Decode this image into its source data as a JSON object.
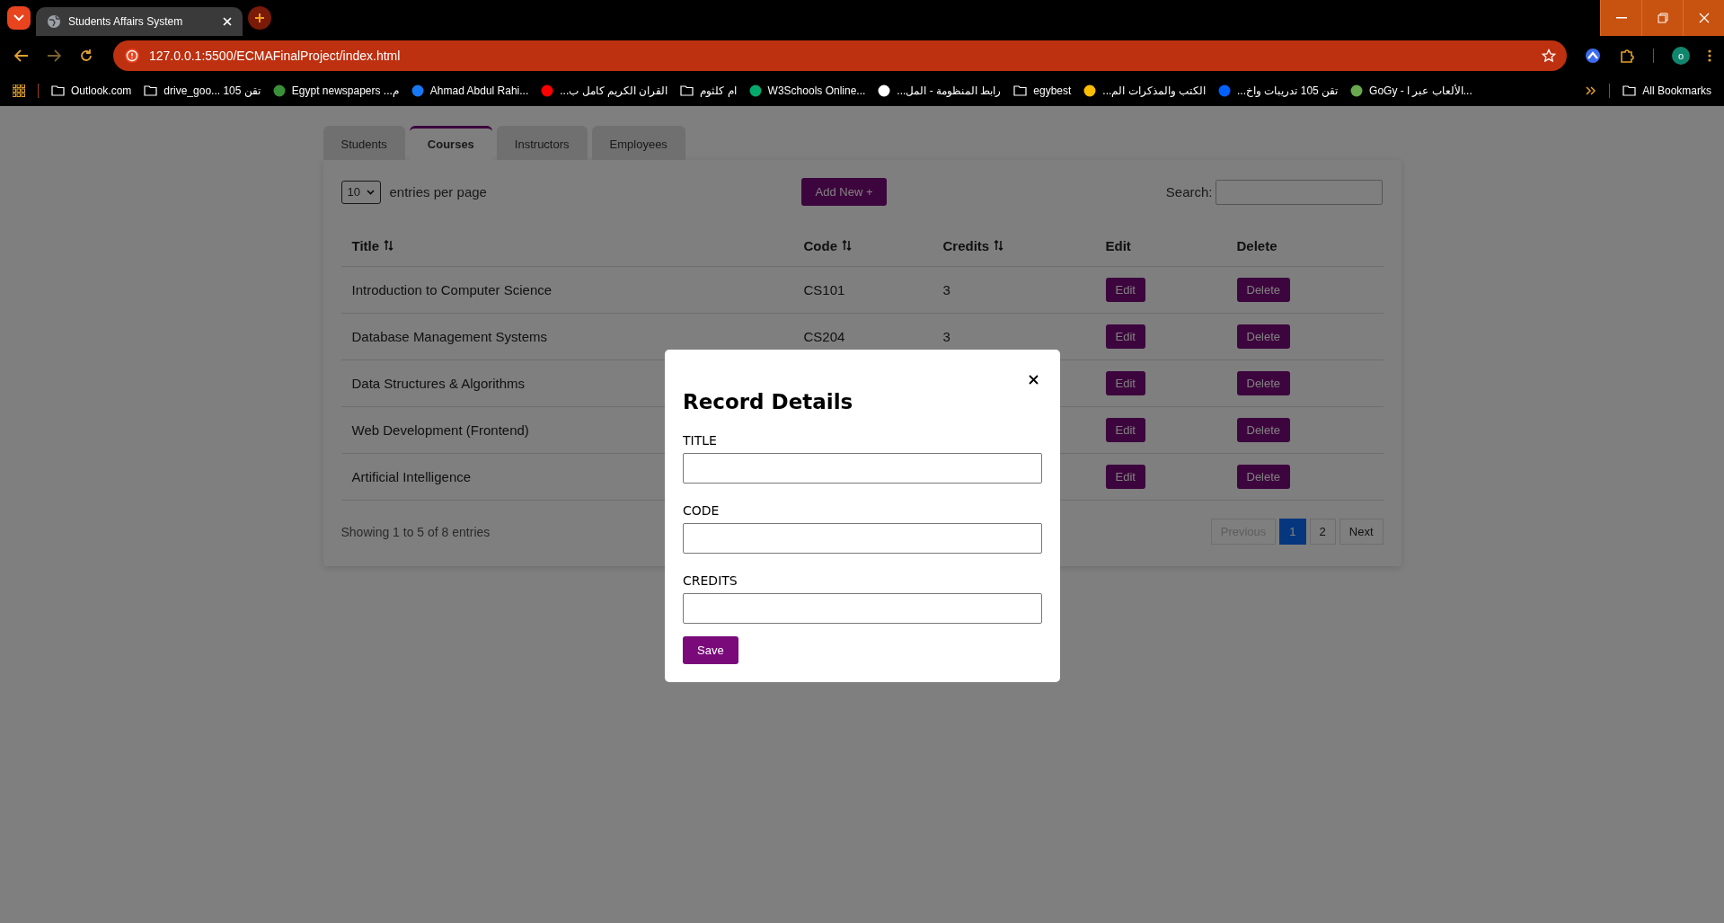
{
  "browser": {
    "tab_title": "Students Affairs System",
    "url": "127.0.0.1:5500/ECMAFinalProject/index.html",
    "profile_initial": "o",
    "all_bookmarks": "All Bookmarks",
    "bookmarks": [
      {
        "label": "Outlook.com",
        "kind": "folder"
      },
      {
        "label": "drive_goo... تقن 105",
        "kind": "folder"
      },
      {
        "label": "Egypt newspapers ...م",
        "kind": "site",
        "color": "#3a8f3a"
      },
      {
        "label": "Ahmad Abdul Rahi...",
        "kind": "site",
        "color": "#1877f2"
      },
      {
        "label": "القران الكريم كامل ب...",
        "kind": "site",
        "color": "#ff0000"
      },
      {
        "label": "ام كلثوم",
        "kind": "folder"
      },
      {
        "label": "W3Schools Online...",
        "kind": "site",
        "color": "#04aa6d"
      },
      {
        "label": "رابط المنظومة - المل...",
        "kind": "site",
        "color": "#ffffff"
      },
      {
        "label": "egybest",
        "kind": "folder"
      },
      {
        "label": "الكتب والمذكرات الم...",
        "kind": "site",
        "color": "#fbbc04"
      },
      {
        "label": "تقن 105 تدريبات واخ...",
        "kind": "site",
        "color": "#0061fe"
      },
      {
        "label": "GoGy - الألعاب عبر ا...",
        "kind": "site",
        "color": "#6aa84f"
      }
    ]
  },
  "tabs": [
    {
      "label": "Students",
      "selected": false
    },
    {
      "label": "Courses",
      "selected": true
    },
    {
      "label": "Instructors",
      "selected": false
    },
    {
      "label": "Employees",
      "selected": false
    }
  ],
  "toolbar": {
    "page_size": "10",
    "page_size_label": "entries per page",
    "add_button": "Add New +",
    "search_label": "Search:"
  },
  "table": {
    "columns": [
      {
        "label": "Title",
        "sortable": true
      },
      {
        "label": "Code",
        "sortable": true
      },
      {
        "label": "Credits",
        "sortable": true
      },
      {
        "label": "Edit",
        "sortable": false
      },
      {
        "label": "Delete",
        "sortable": false
      }
    ],
    "rows": [
      {
        "title": "Introduction to Computer Science",
        "code": "CS101",
        "credits": "3",
        "edit": "Edit",
        "delete": "Delete"
      },
      {
        "title": "Database Management Systems",
        "code": "CS204",
        "credits": "3",
        "edit": "Edit",
        "delete": "Delete"
      },
      {
        "title": "Data Structures & Algorithms",
        "edit": "Edit",
        "delete": "Delete"
      },
      {
        "title": "Web Development (Frontend)",
        "edit": "Edit",
        "delete": "Delete"
      },
      {
        "title": "Artificial Intelligence",
        "edit": "Edit",
        "delete": "Delete"
      }
    ]
  },
  "footer": {
    "info": "Showing 1 to 5 of 8 entries",
    "pages": [
      {
        "label": "Previous",
        "selected": false,
        "disabled": true
      },
      {
        "label": "1",
        "selected": true,
        "disabled": false
      },
      {
        "label": "2",
        "selected": false,
        "disabled": false
      },
      {
        "label": "Next",
        "selected": false,
        "disabled": false
      }
    ]
  },
  "modal": {
    "title": "Record Details",
    "fields": [
      {
        "label": "TITLE"
      },
      {
        "label": "CODE"
      },
      {
        "label": "CREDITS"
      }
    ],
    "save_button": "Save"
  }
}
